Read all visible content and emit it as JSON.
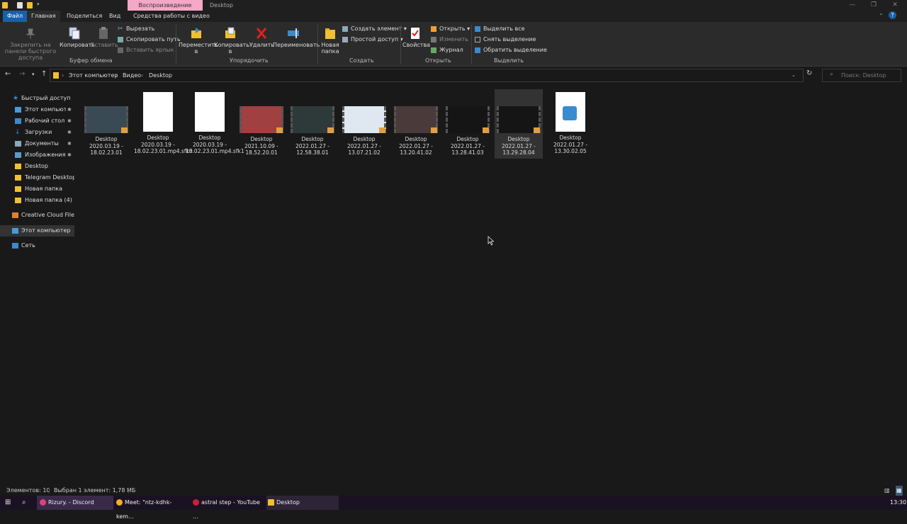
{
  "window": {
    "title": "Desktop",
    "context_tab": "Воспроизведение",
    "controls": {
      "minimize": "—",
      "maximize": "❐",
      "close": "✕"
    },
    "help_icon": "?"
  },
  "ribbon_tabs": [
    "Файл",
    "Главная",
    "Поделиться",
    "Вид",
    "Средства работы с видео"
  ],
  "ribbon": {
    "clipboard": {
      "pin_label": "Закрепить на панели быстрого доступа",
      "copy_label": "Копировать",
      "paste_label": "Вставить",
      "cut_label": "Вырезать",
      "copy_path_label": "Скопировать путь",
      "paste_shortcut_label": "Вставить ярлык",
      "group_label": "Буфер обмена"
    },
    "organize": {
      "move_label": "Переместить в",
      "copy_to_label": "Копировать в",
      "delete_label": "Удалить",
      "rename_label": "Переименовать",
      "group_label": "Упорядочить"
    },
    "new": {
      "new_folder_label": "Новая папка",
      "new_item_label": "Создать элемент",
      "easy_access_label": "Простой доступ",
      "group_label": "Создать"
    },
    "open": {
      "properties_label": "Свойства",
      "open_label": "Открыть",
      "edit_label": "Изменить",
      "history_label": "Журнал",
      "group_label": "Открыть"
    },
    "select": {
      "select_all_label": "Выделить все",
      "select_none_label": "Снять выделение",
      "invert_label": "Обратить выделение",
      "group_label": "Выделить"
    }
  },
  "address": {
    "crumbs": [
      "Этот компьютер",
      "Видео",
      "Desktop"
    ],
    "search_placeholder": "Поиск: Desktop"
  },
  "sidebar": {
    "items": [
      {
        "label": "Быстрый доступ",
        "icon": "star-icon",
        "pinned": false
      },
      {
        "label": "Этот компьютер",
        "icon": "computer-icon",
        "pinned": true
      },
      {
        "label": "Рабочий стол",
        "icon": "desktop-folder-icon",
        "pinned": true
      },
      {
        "label": "Загрузки",
        "icon": "download-icon",
        "pinned": true
      },
      {
        "label": "Документы",
        "icon": "documents-icon",
        "pinned": true
      },
      {
        "label": "Изображения",
        "icon": "pictures-icon",
        "pinned": true
      },
      {
        "label": "Desktop",
        "icon": "folder-icon",
        "pinned": false
      },
      {
        "label": "Telegram Desktop",
        "icon": "folder-icon",
        "pinned": false
      },
      {
        "label": "Новая папка",
        "icon": "folder-icon",
        "pinned": false
      },
      {
        "label": "Новая папка (4)",
        "icon": "folder-icon",
        "pinned": false
      },
      {
        "label": "Creative Cloud Files",
        "icon": "cloud-folder-icon",
        "pinned": false
      },
      {
        "label": "Этот компьютер",
        "icon": "computer-icon",
        "pinned": false
      },
      {
        "label": "Сеть",
        "icon": "network-icon",
        "pinned": false
      }
    ]
  },
  "files": [
    {
      "name": "Desktop 2020.03.19 - 18.02.23.01",
      "kind": "video",
      "thumb_color": "#3a4a55"
    },
    {
      "name": "Desktop 2020.03.19 - 18.02.23.01.mp4.sfk0",
      "kind": "blank",
      "thumb_color": "#ffffff"
    },
    {
      "name": "Desktop 2020.03.19 - 18.02.23.01.mp4.sfk1",
      "kind": "blank",
      "thumb_color": "#ffffff"
    },
    {
      "name": "Desktop 2021.10.09 - 18.52.20.01",
      "kind": "video",
      "thumb_color": "#a04040"
    },
    {
      "name": "Desktop 2022.01.27 - 12.58.38.01",
      "kind": "video",
      "thumb_color": "#2e3a3a"
    },
    {
      "name": "Desktop 2022.01.27 - 13.07.21.02",
      "kind": "video",
      "thumb_color": "#dfe8f0"
    },
    {
      "name": "Desktop 2022.01.27 - 13.20.41.02",
      "kind": "video",
      "thumb_color": "#4a3a3a"
    },
    {
      "name": "Desktop 2022.01.27 - 13.28.41.03",
      "kind": "video",
      "thumb_color": "#151515"
    },
    {
      "name": "Desktop 2022.01.27 - 13.29.28.04",
      "kind": "video",
      "thumb_color": "#151515"
    },
    {
      "name": "Desktop 2022.01.27 - 13.30.02.05",
      "kind": "media",
      "thumb_color": "#ffffff"
    }
  ],
  "selected_file_index": 8,
  "status": {
    "items_count": "Элементов: 10",
    "selection": "Выбран 1 элемент: 1,78 МБ"
  },
  "taskbar": {
    "items": [
      {
        "label": "Rizury. - Discord",
        "icon": "discord-icon",
        "color": "#e04080"
      },
      {
        "label": "Meet: \"ntz-kdhk-kem...",
        "icon": "chrome-icon",
        "color": "#f0b020"
      },
      {
        "label": "astral step - YouTube ...",
        "icon": "opera-icon",
        "color": "#d02030"
      },
      {
        "label": "Desktop",
        "icon": "explorer-icon",
        "color": "#f0c030"
      }
    ],
    "clock": "13:30"
  }
}
